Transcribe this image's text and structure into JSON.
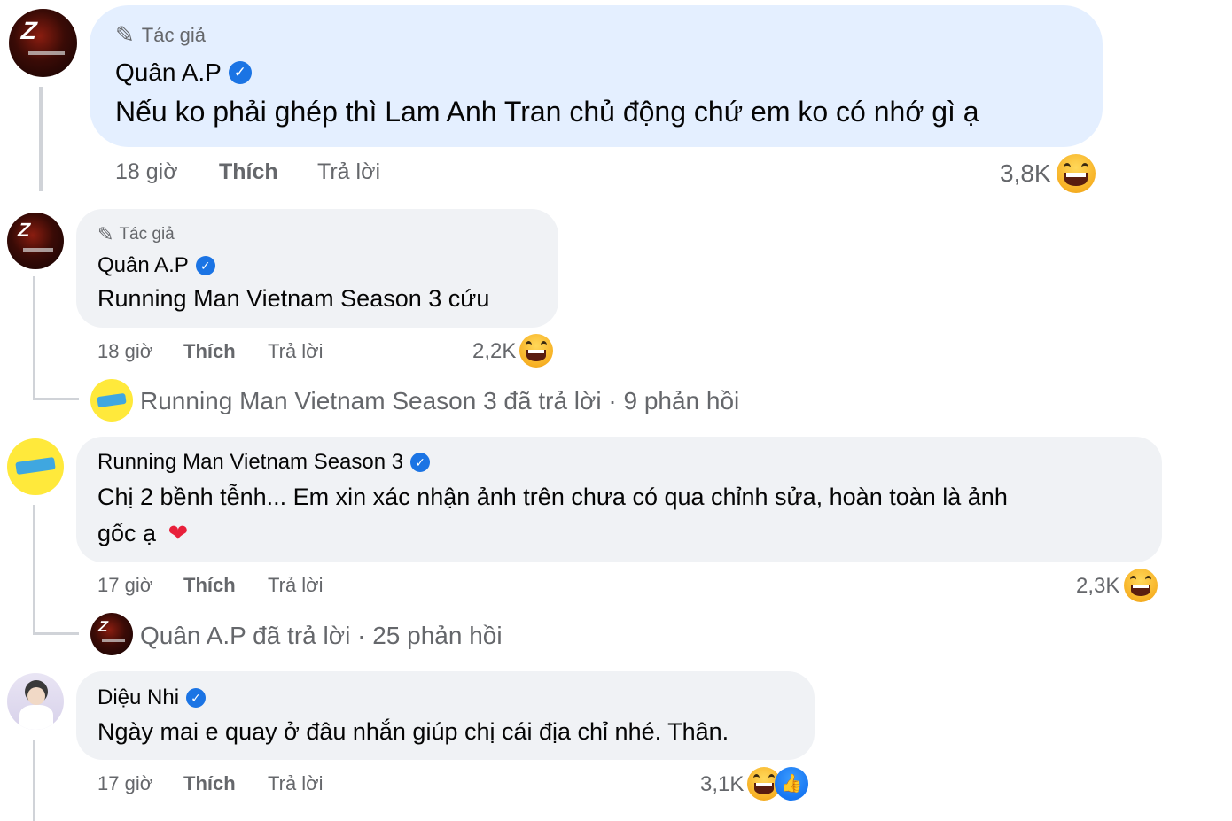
{
  "comments": [
    {
      "author_badge": "Tác giả",
      "author": "Quân A.P",
      "text": "Nếu ko phải ghép thì Lam Anh Tran chủ động chứ em ko có nhớ gì ạ",
      "time": "18 giờ",
      "like_label": "Thích",
      "reply_label": "Trả lời",
      "reaction_count": "3,8K",
      "reaction_icons": [
        "haha-emoji-icon"
      ]
    },
    {
      "author_badge": "Tác giả",
      "author": "Quân A.P",
      "text": "Running Man Vietnam Season 3 cứu",
      "time": "18 giờ",
      "like_label": "Thích",
      "reply_label": "Trả lời",
      "reaction_count": "2,2K",
      "reaction_icons": [
        "haha-emoji-icon"
      ],
      "replies_summary": "Running Man Vietnam Season 3 đã trả lời · 9 phản hồi"
    },
    {
      "author": "Running Man Vietnam Season 3",
      "text_line1": "Chị 2 bềnh tễnh... Em xin xác nhận ảnh trên chưa có qua chỉnh sửa, hoàn toàn là ảnh",
      "text_line2": "gốc ạ",
      "text_emoji": "❤",
      "time": "17 giờ",
      "like_label": "Thích",
      "reply_label": "Trả lời",
      "reaction_count": "2,3K",
      "reaction_icons": [
        "haha-emoji-icon"
      ],
      "replies_summary": "Quân A.P đã trả lời · 25 phản hồi"
    },
    {
      "author": "Diệu Nhi",
      "text": "Ngày mai e quay ở đâu nhắn giúp chị cái địa chỉ nhé. Thân.",
      "time": "17 giờ",
      "like_label": "Thích",
      "reply_label": "Trả lời",
      "reaction_count": "3,1K",
      "reaction_icons": [
        "haha-emoji-icon",
        "like-icon"
      ]
    }
  ],
  "icons": {
    "author_badge": "pen-icon",
    "verified": "verified-check-icon"
  },
  "colors": {
    "verified": "#1b74e4",
    "bubble": "#f0f2f5",
    "highlight_bubble": "#e4efff",
    "meta_text": "#65676b"
  }
}
